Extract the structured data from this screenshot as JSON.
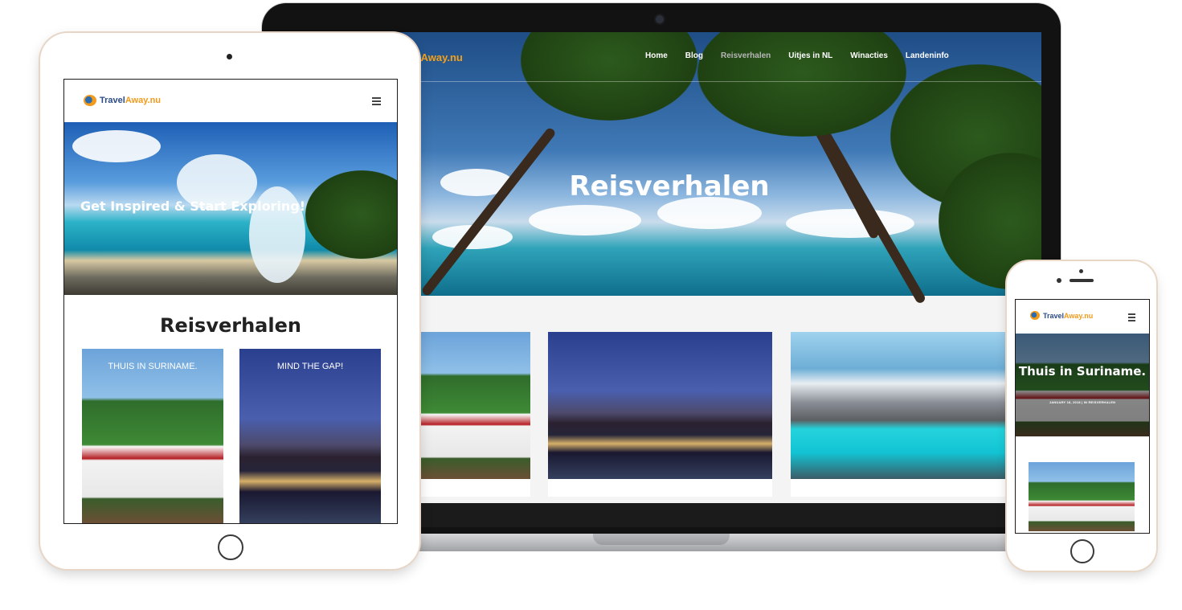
{
  "laptop": {
    "logo_text": "lAway.nu",
    "nav": [
      {
        "label": "Home"
      },
      {
        "label": "Blog"
      },
      {
        "label": "Reisverhalen",
        "active": true
      },
      {
        "label": "Uitjes in NL"
      },
      {
        "label": "Winacties"
      },
      {
        "label": "Landeninfo"
      }
    ],
    "hero_title": "Reisverhalen"
  },
  "tablet": {
    "logo_part1": "Travel",
    "logo_part2": "Away.nu",
    "hero_text": "Get Inspired & Start Exploring!",
    "section_title": "Reisverhalen",
    "cards": [
      {
        "label": "THUIS IN SURINAME."
      },
      {
        "label": "MIND THE GAP!"
      }
    ]
  },
  "phone": {
    "logo_part1": "Travel",
    "logo_part2": "Away.nu",
    "hero_title": "Thuis in Suriname.",
    "hero_meta": "JANUARY 18, 2018 | IN REISVERHALEN"
  },
  "colors": {
    "brand_orange": "#f29a1b",
    "brand_blue": "#2b4b86"
  },
  "icons": {
    "menu": "hamburger-icon",
    "logo": "globe-plane-icon"
  }
}
